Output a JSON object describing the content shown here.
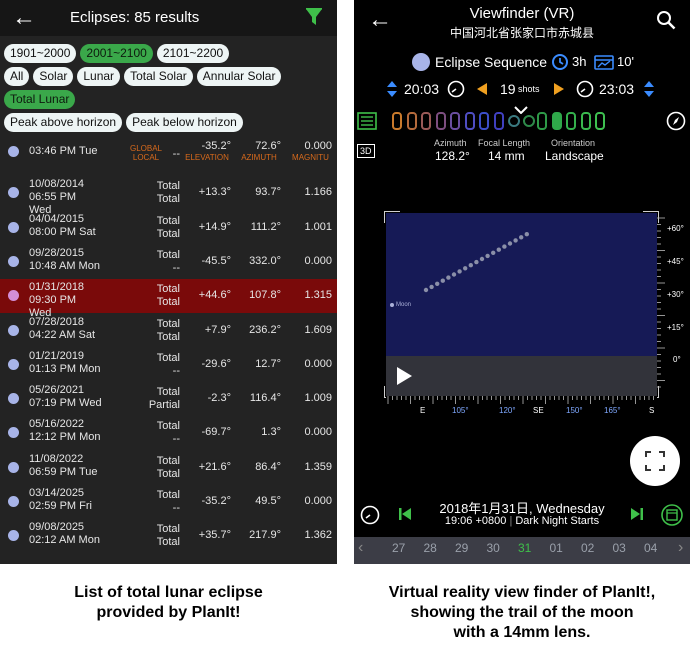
{
  "left": {
    "header": {
      "title": "Eclipses: 85 results"
    },
    "chips": {
      "row1": [
        "1901~2000",
        "2001~2100",
        "2101~2200"
      ],
      "row2": [
        "All",
        "Solar",
        "Lunar",
        "Total Solar",
        "Annular Solar"
      ],
      "row3": [
        "Total Lunar"
      ],
      "row4": [
        "Peak above horizon",
        "Peak below horizon"
      ]
    },
    "columns": {
      "global": "GLOBAL LOCAL",
      "elevation": "ELEVATION",
      "azimuth": "AZIMUTH",
      "magnitude": "MAGNITU"
    },
    "rows": [
      {
        "d1": "03:46 PM Tue",
        "d2": "",
        "d3": "",
        "g1": "--",
        "g2": "",
        "elev": "-35.2°",
        "az": "72.6°",
        "mag": "0.000"
      },
      {
        "d1": "10/08/2014",
        "d2": "06:55 PM",
        "d3": "Wed",
        "g1": "Total",
        "g2": "Total",
        "elev": "+13.3°",
        "az": "93.7°",
        "mag": "1.166"
      },
      {
        "d1": "04/04/2015",
        "d2": "08:00 PM Sat",
        "d3": "",
        "g1": "Total",
        "g2": "Total",
        "elev": "+14.9°",
        "az": "111.2°",
        "mag": "1.001"
      },
      {
        "d1": "09/28/2015",
        "d2": "10:48 AM Mon",
        "d3": "",
        "g1": "Total",
        "g2": "--",
        "elev": "-45.5°",
        "az": "332.0°",
        "mag": "0.000"
      },
      {
        "d1": "01/31/2018",
        "d2": "09:30 PM",
        "d3": "Wed",
        "g1": "Total",
        "g2": "Total",
        "elev": "+44.6°",
        "az": "107.8°",
        "mag": "1.315"
      },
      {
        "d1": "07/28/2018",
        "d2": "04:22 AM Sat",
        "d3": "",
        "g1": "Total",
        "g2": "Total",
        "elev": "+7.9°",
        "az": "236.2°",
        "mag": "1.609"
      },
      {
        "d1": "01/21/2019",
        "d2": "01:13 PM Mon",
        "d3": "",
        "g1": "Total",
        "g2": "--",
        "elev": "-29.6°",
        "az": "12.7°",
        "mag": "0.000"
      },
      {
        "d1": "05/26/2021",
        "d2": "07:19 PM Wed",
        "d3": "",
        "g1": "Total",
        "g2": "Partial",
        "elev": "-2.3°",
        "az": "116.4°",
        "mag": "1.009"
      },
      {
        "d1": "05/16/2022",
        "d2": "12:12 PM Mon",
        "d3": "",
        "g1": "Total",
        "g2": "--",
        "elev": "-69.7°",
        "az": "1.3°",
        "mag": "0.000"
      },
      {
        "d1": "11/08/2022",
        "d2": "06:59 PM Tue",
        "d3": "",
        "g1": "Total",
        "g2": "Total",
        "elev": "+21.6°",
        "az": "86.4°",
        "mag": "1.359"
      },
      {
        "d1": "03/14/2025",
        "d2": "02:59 PM Fri",
        "d3": "",
        "g1": "Total",
        "g2": "--",
        "elev": "-35.2°",
        "az": "49.5°",
        "mag": "0.000"
      },
      {
        "d1": "09/08/2025",
        "d2": "02:12 AM Mon",
        "d3": "",
        "g1": "Total",
        "g2": "Total",
        "elev": "+35.7°",
        "az": "217.9°",
        "mag": "1.362"
      }
    ],
    "caption": [
      "List of total lunar eclipse",
      "provided by PlanIt!"
    ]
  },
  "right": {
    "header": {
      "title": "Viewfinder (VR)",
      "subtitle": "中国河北省张家口市赤城县"
    },
    "sequence": {
      "label": "Eclipse Sequence",
      "interval": "3h",
      "duration": "10'"
    },
    "timeline": {
      "start": "20:03",
      "shots": "19",
      "shots_unit": "shots",
      "end": "23:03"
    },
    "camera": {
      "azimuth_label": "Azimuth",
      "azimuth": "128.2°",
      "focal_label": "Focal Length",
      "focal": "14 mm",
      "orientation_label": "Orientation",
      "orientation": "Landscape"
    },
    "toggle_3d": "3D",
    "moon_label": "Moon",
    "ruler": [
      "E",
      "105°",
      "120°",
      "SE",
      "150°",
      "165°",
      "S"
    ],
    "scale": [
      "+60°",
      "+45°",
      "+30°",
      "+15°",
      "0°"
    ],
    "date": "2018年1月31日, Wednesday",
    "time": "19:06 +0800",
    "phase": "Dark Night Starts",
    "days": [
      "27",
      "28",
      "29",
      "30",
      "31",
      "01",
      "02",
      "03",
      "04"
    ],
    "caption": [
      "Virtual reality view finder of PlanIt!,",
      "showing the trail of the moon",
      "with a 14mm lens."
    ]
  }
}
